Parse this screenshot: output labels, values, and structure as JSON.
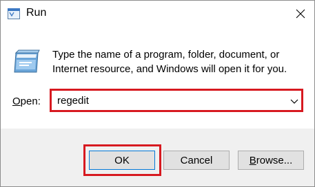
{
  "window": {
    "title": "Run"
  },
  "description": "Type the name of a program, folder, document, or Internet resource, and Windows will open it for you.",
  "open_field": {
    "label_underlined": "O",
    "label_rest": "pen:",
    "value": "regedit"
  },
  "buttons": {
    "ok": "OK",
    "cancel": "Cancel",
    "browse_underlined": "B",
    "browse_rest": "rowse..."
  },
  "colors": {
    "highlight": "#d71920",
    "focus_border": "#0078d7",
    "footer_bg": "#f0f0f0"
  },
  "icons": [
    "run-app-icon",
    "close-icon",
    "run-program-icon",
    "chevron-down-icon"
  ]
}
